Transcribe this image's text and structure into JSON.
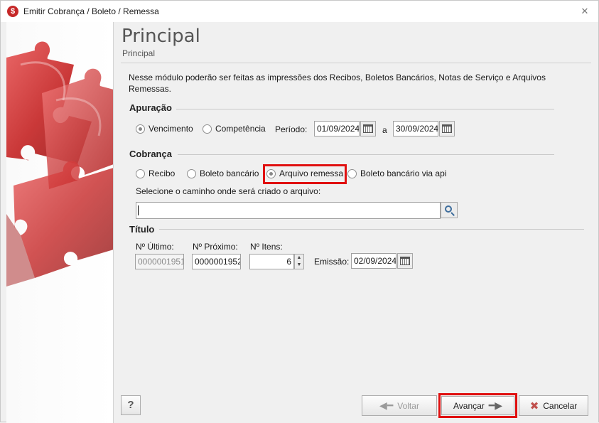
{
  "window": {
    "title": "Emitir Cobrança / Boleto / Remessa",
    "app_icon": "$"
  },
  "page": {
    "title": "Principal",
    "subtitle": "Principal"
  },
  "description": "Nesse módulo poderão ser feitas as impressões dos Recibos, Boletos Bancários, Notas de Serviço e Arquivos Remessas.",
  "apuracao": {
    "label": "Apuração",
    "options": [
      "Vencimento",
      "Competência"
    ],
    "selected": "Vencimento",
    "periodo_label": "Período:",
    "date_from": "01/09/2024",
    "date_sep": "a",
    "date_to": "30/09/2024"
  },
  "cobranca": {
    "label": "Cobrança",
    "options": [
      "Recibo",
      "Boleto bancário",
      "Arquivo remessa",
      "Boleto bancário via api"
    ],
    "selected": "Arquivo remessa",
    "path_label": "Selecione o caminho onde será criado o arquivo:",
    "path_value": ""
  },
  "titulo": {
    "label": "Título",
    "ultimo_label": "Nº Último:",
    "ultimo_value": "0000001951",
    "proximo_label": "Nº Próximo:",
    "proximo_value": "0000001952",
    "itens_label": "Nº Itens:",
    "itens_value": "6",
    "emissao_label": "Emissão:",
    "emissao_value": "02/09/2024"
  },
  "footer": {
    "help": "?",
    "voltar": "Voltar",
    "avancar": "Avançar",
    "cancelar": "Cancelar"
  },
  "colors": {
    "highlight": "#e01010",
    "accent": "#3e6d9c",
    "puzzle": "#c62828"
  }
}
